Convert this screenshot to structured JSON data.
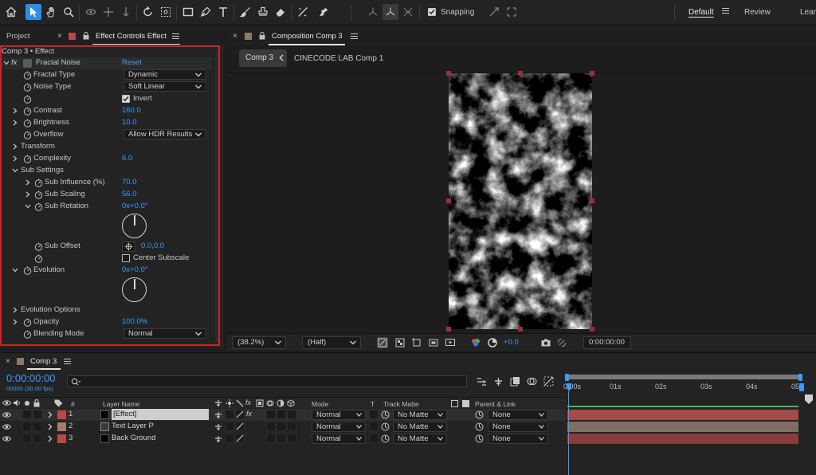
{
  "toolbar": {
    "snapping_label": "Snapping",
    "workspaces": [
      "Default",
      "Review",
      "Lear"
    ],
    "active_workspace": "Default",
    "accent_color": "#2d8ceb"
  },
  "effect_panel": {
    "tabs": {
      "project": "Project",
      "effect_controls": "Effect Controls Effect"
    },
    "breadcrumb": "Comp 3 • Effect",
    "effect_name": "Fractal Noise",
    "reset_label": "Reset",
    "fx_label": "fx",
    "properties": {
      "fractal_type": {
        "label": "Fractal Type",
        "value": "Dynamic"
      },
      "noise_type": {
        "label": "Noise Type",
        "value": "Soft Linear"
      },
      "invert": {
        "label": "Invert"
      },
      "contrast": {
        "label": "Contrast",
        "value": "160.0"
      },
      "brightness": {
        "label": "Brightness",
        "value": "10.0"
      },
      "overflow": {
        "label": "Overflow",
        "value": "Allow HDR Results"
      },
      "transform": {
        "label": "Transform"
      },
      "complexity": {
        "label": "Complexity",
        "value": "6.0"
      },
      "sub_settings": {
        "label": "Sub Settings"
      },
      "sub_influence": {
        "label": "Sub Influence (%)",
        "value": "70.0"
      },
      "sub_scaling": {
        "label": "Sub Scaling",
        "value": "56.0"
      },
      "sub_rotation": {
        "label": "Sub Rotation",
        "value": "0x+0.0°"
      },
      "sub_offset": {
        "label": "Sub Offset",
        "value": "0.0,0.0"
      },
      "center_subscale": {
        "label": "Center Subscale"
      },
      "evolution": {
        "label": "Evolution",
        "value": "0x+0.0°"
      },
      "evolution_options": {
        "label": "Evolution Options"
      },
      "opacity": {
        "label": "Opacity",
        "value": "100.0%"
      },
      "blending_mode": {
        "label": "Blending Mode",
        "value": "Normal"
      }
    },
    "highlight_color": "#d0212b"
  },
  "composition_panel": {
    "tab_title": "Composition Comp 3",
    "breadcrumb_active": "Comp 3",
    "breadcrumb_other": "CINECODE LAB Comp 1",
    "zoom": "(38.2%)",
    "resolution": "(Half)",
    "exposure": "+0.0",
    "timecode": "0:00:00:00"
  },
  "timeline": {
    "tab_title": "Comp 3",
    "current_time": "0:00:00:00",
    "fps_readout": "00000 (30.00 fps)",
    "search_placeholder": "",
    "headers": {
      "hash": "#",
      "layer_name": "Layer Name",
      "mode": "Mode",
      "t": "T",
      "track_matte": "Track Matte",
      "parent_link": "Parent & Link"
    },
    "ruler": [
      "0:00s",
      "01s",
      "02s",
      "03s",
      "04s",
      "05s"
    ],
    "layers": [
      {
        "num": "1",
        "name": "[Effect]",
        "mode": "Normal",
        "matte": "No Matte",
        "parent": "None",
        "color": "#b84a4a"
      },
      {
        "num": "2",
        "name": "Text Layer P",
        "mode": "Normal",
        "matte": "No Matte",
        "parent": "None",
        "color": "#a57c6a"
      },
      {
        "num": "3",
        "name": "Back Ground",
        "mode": "Normal",
        "matte": "No Matte",
        "parent": "None",
        "color": "#b84a4a"
      }
    ]
  }
}
